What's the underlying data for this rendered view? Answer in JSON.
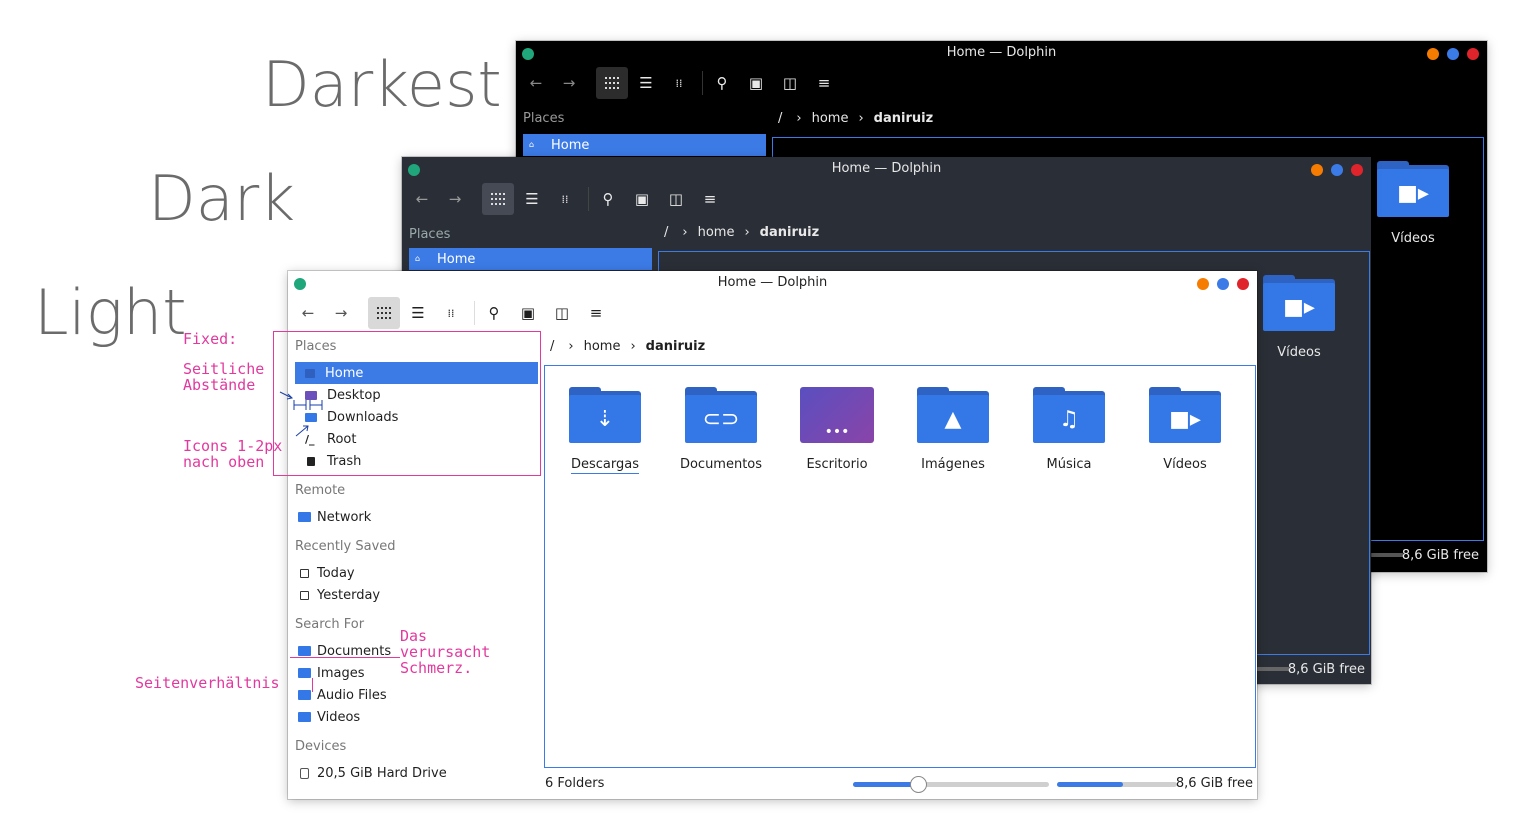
{
  "labels": {
    "darkest": "Darkest",
    "dark": "Dark",
    "light": "Light"
  },
  "window_darkest": {
    "title": "Home — Dolphin",
    "sidebar_header": "Places",
    "sidebar_item": "Home",
    "breadcrumb": {
      "root": "/",
      "home": "home",
      "current": "daniruiz"
    },
    "folder": "Vídeos",
    "free": "8,6 GiB free"
  },
  "window_dark": {
    "title": "Home — Dolphin",
    "sidebar_header": "Places",
    "sidebar_item": "Home",
    "breadcrumb": {
      "root": "/",
      "home": "home",
      "current": "daniruiz"
    },
    "folder": "Vídeos",
    "free": "8,6 GiB free"
  },
  "window_light": {
    "title": "Home — Dolphin",
    "sidebar": {
      "places_header": "Places",
      "places": [
        "Home",
        "Desktop",
        "Downloads",
        "Root",
        "Trash"
      ],
      "remote_header": "Remote",
      "remote": [
        "Network"
      ],
      "recent_header": "Recently Saved",
      "recent": [
        "Today",
        "Yesterday"
      ],
      "search_header": "Search For",
      "search": [
        "Documents",
        "Images",
        "Audio Files",
        "Videos"
      ],
      "devices_header": "Devices",
      "devices": [
        "20,5 GiB Hard Drive"
      ]
    },
    "breadcrumb": {
      "root": "/",
      "home": "home",
      "current": "daniruiz"
    },
    "folders": [
      "Descargas",
      "Documentos",
      "Escritorio",
      "Imágenes",
      "Música",
      "Vídeos"
    ],
    "status": {
      "count": "6 Folders",
      "free": "8,6 GiB free",
      "zoom_level": 0.33,
      "disk_used": 0.55
    }
  },
  "annotations": {
    "fixed": "Fixed:",
    "spacing": "Seitliche\nAbstände",
    "icons": "Icons 1-2px\nnach oben",
    "pain": "Das\nverursacht\nSchmerz.",
    "ratio": "Seitenverhältnis"
  },
  "colors": {
    "accent": "#3c7be6",
    "annotation": "#e2399f",
    "dot_green": "#1fa67a",
    "dot_orange": "#f57c00",
    "dot_blue": "#3b7be8",
    "dot_red": "#e0242b"
  }
}
